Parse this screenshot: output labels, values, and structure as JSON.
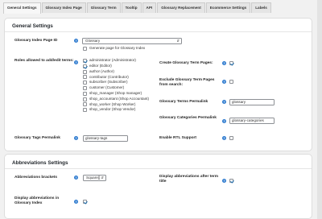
{
  "tabs": [
    "General Settings",
    "Glossary Index Page",
    "Glossary Term",
    "Tooltip",
    "API",
    "Glossary Replacement",
    "Ecommerce Settings",
    "Labels"
  ],
  "general": {
    "title": "General Settings",
    "index_page": {
      "label": "Glossary Index Page ID",
      "selected": "Glossary",
      "generate_label": "Generate page for Glossary Index"
    },
    "roles": {
      "label": "Roles allowed to add/edit terms:",
      "items": [
        {
          "name": "administrator (Administrator)",
          "checked": true
        },
        {
          "name": "editor (Editor)",
          "checked": true
        },
        {
          "name": "author (Author)",
          "checked": false
        },
        {
          "name": "contributor (Contributor)",
          "checked": false
        },
        {
          "name": "subscriber (Subscriber)",
          "checked": false
        },
        {
          "name": "customer (Customer)",
          "checked": false
        },
        {
          "name": "shop_manager (Shop manager)",
          "checked": false
        },
        {
          "name": "shop_accountant (Shop Accountant)",
          "checked": false
        },
        {
          "name": "shop_worker (Shop Worker)",
          "checked": false
        },
        {
          "name": "shop_vendor (Shop Vendor)",
          "checked": false
        }
      ]
    },
    "create_pages": {
      "label": "Create Glossary Term Pages:",
      "checked": true
    },
    "exclude_search": {
      "label": "Exclude Glossary Term Pages from search:",
      "checked": false
    },
    "terms_permalink": {
      "label": "Glossary Terms Permalink",
      "value": "glossary"
    },
    "categories_permalink": {
      "label": "Glossary Categories Permalink",
      "value": "glossary-categories"
    },
    "tags_permalink": {
      "label": "Glossary Tags Permalink",
      "value": "glossary-tags"
    },
    "rtl": {
      "label": "Enable RTL Support",
      "checked": false
    }
  },
  "abbr": {
    "title": "Abbreviations Settings",
    "brackets": {
      "label": "Abbreviations brackets",
      "selected": "Square[]"
    },
    "after_title": {
      "label": "Display abbreviations after term title",
      "checked": true
    },
    "in_index": {
      "label": "Display abbreviations in Glossary Index",
      "checked": true
    }
  },
  "colors": {
    "accent": "#2271b1",
    "help": "#2e7bcf",
    "panel_border": "#dddddd"
  }
}
